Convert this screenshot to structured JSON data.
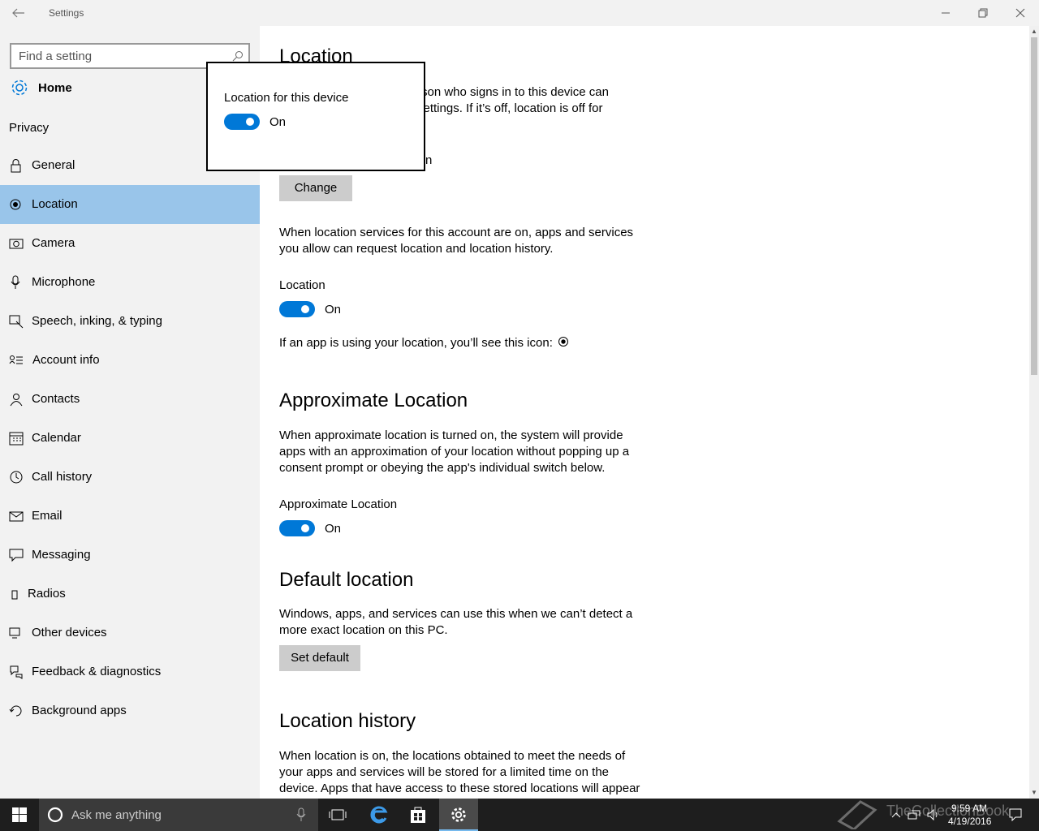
{
  "window": {
    "title": "Settings"
  },
  "sidebar": {
    "search_placeholder": "Find a setting",
    "home_label": "Home",
    "section": "Privacy",
    "items": [
      {
        "label": "General",
        "icon": "lock-icon"
      },
      {
        "label": "Location",
        "icon": "location-icon",
        "active": true
      },
      {
        "label": "Camera",
        "icon": "camera-icon"
      },
      {
        "label": "Microphone",
        "icon": "microphone-icon"
      },
      {
        "label": "Speech, inking, & typing",
        "icon": "speech-icon"
      },
      {
        "label": "Account info",
        "icon": "account-info-icon"
      },
      {
        "label": "Contacts",
        "icon": "contacts-icon"
      },
      {
        "label": "Calendar",
        "icon": "calendar-icon"
      },
      {
        "label": "Call history",
        "icon": "call-history-icon"
      },
      {
        "label": "Email",
        "icon": "email-icon"
      },
      {
        "label": "Messaging",
        "icon": "messaging-icon"
      },
      {
        "label": "Radios",
        "icon": "radios-icon"
      },
      {
        "label": "Other devices",
        "icon": "other-devices-icon"
      },
      {
        "label": "Feedback & diagnostics",
        "icon": "feedback-icon"
      },
      {
        "label": "Background apps",
        "icon": "background-apps-icon"
      }
    ]
  },
  "main": {
    "heading": "Location",
    "intro_line1": "rson who signs in to this device can",
    "intro_line2": "settings. If it’s off, location is off for",
    "status_fragment": "n",
    "change_button": "Change",
    "account_text": "When location services for this account are on, apps and services you allow can request location and location history.",
    "location_label": "Location",
    "location_toggle": "On",
    "icon_text": "If an app is using your location, you’ll see this icon:",
    "approx_heading": "Approximate Location",
    "approx_text": "When approximate location is turned on, the system will provide apps with an approximation of your location without popping up a consent prompt or obeying the app's individual switch below.",
    "approx_label": "Approximate Location",
    "approx_toggle": "On",
    "default_heading": "Default location",
    "default_text": "Windows, apps, and services can use this when we can’t detect a more exact location on this PC.",
    "default_button": "Set default",
    "history_heading": "Location history",
    "history_text": "When location is on, the locations obtained to meet the needs of your apps and services will be stored for a limited time on the device. Apps that have access to these stored locations will appear"
  },
  "popup": {
    "label": "Location for this device",
    "toggle": "On"
  },
  "taskbar": {
    "search_placeholder": "Ask me anything",
    "time": "9:59 AM",
    "date": "4/19/2016",
    "watermark": "TheCollectionBook"
  },
  "colors": {
    "accent": "#0078d7",
    "nav_selected": "#99c5ea",
    "sidebar_bg": "#f2f2f2",
    "taskbar_bg": "#1e1e1e"
  }
}
